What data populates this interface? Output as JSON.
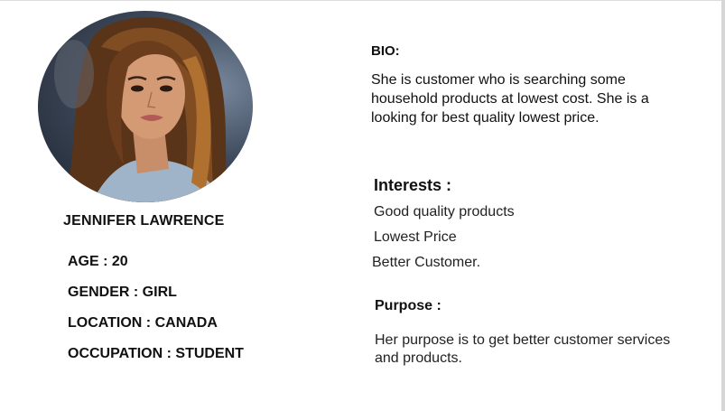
{
  "profile": {
    "name": "JENNIFER LAWRENCE",
    "age": "AGE : 20",
    "gender": "GENDER : GIRL",
    "location": "LOCATION : CANADA",
    "occupation": "OCCUPATION : STUDENT"
  },
  "bio": {
    "title": "BIO:",
    "text": "She is customer who is searching some household products at lowest cost. She is a looking for best quality lowest price."
  },
  "interests": {
    "title": "Interests :",
    "items": [
      "Good quality products",
      "Lowest Price",
      "Better Customer."
    ]
  },
  "purpose": {
    "title": "Purpose :",
    "text": "Her purpose is to get better customer services and products."
  },
  "colors": {
    "text": "#111111",
    "background": "#ffffff"
  }
}
